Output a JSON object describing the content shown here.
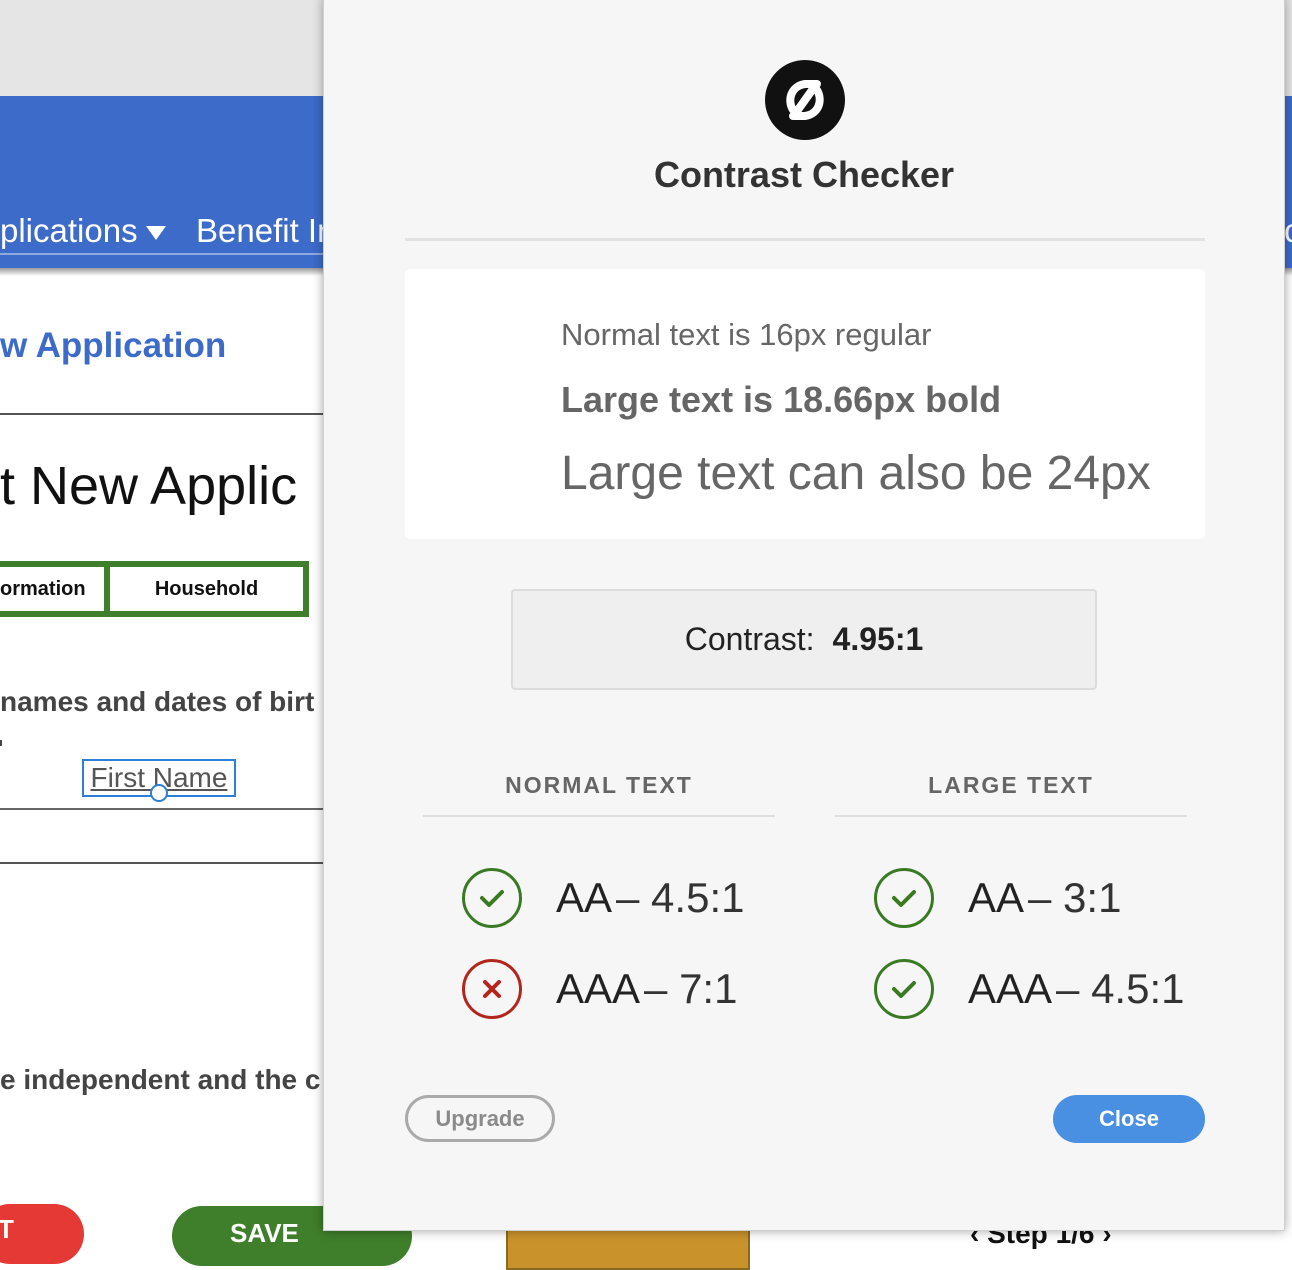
{
  "background_page": {
    "nav": {
      "applications_label": "plications",
      "benefit_label": "Benefit In",
      "right_partial": "c"
    },
    "page_link": "w Application",
    "heading": "t New Applic",
    "step_tabs": [
      {
        "label": "ormation"
      },
      {
        "label": "Household"
      }
    ],
    "names_text": "names and dates of birt",
    "first_name_field": "First Name",
    "independent_text": "e independent and the c",
    "buttons": {
      "red_label": "T",
      "save_label": "SAVE",
      "step_label": "Step 1/6"
    }
  },
  "dialog": {
    "title": "Contrast Checker",
    "samples": {
      "normal": "Normal text is 16px regular",
      "bold": "Large text is 18.66px bold",
      "large": "Large text can also be 24px"
    },
    "contrast_label": "Contrast:",
    "contrast_value": "4.95:1",
    "columns": {
      "normal_header": "NORMAL TEXT",
      "large_header": "LARGE TEXT"
    },
    "results": {
      "normal_aa": {
        "label": "AA",
        "ratio": "– 4.5:1",
        "status": "pass"
      },
      "normal_aaa": {
        "label": "AAA",
        "ratio": "– 7:1",
        "status": "fail"
      },
      "large_aa": {
        "label": "AA",
        "ratio": "– 3:1",
        "status": "pass"
      },
      "large_aaa": {
        "label": "AAA",
        "ratio": "– 4.5:1",
        "status": "pass"
      }
    },
    "upgrade_label": "Upgrade",
    "close_label": "Close"
  },
  "colors": {
    "header_blue": "#3d6bc9",
    "tab_green": "#3f7e2a",
    "pass_green": "#3a7a23",
    "fail_red": "#b3261e",
    "close_button": "#4a90e2"
  }
}
